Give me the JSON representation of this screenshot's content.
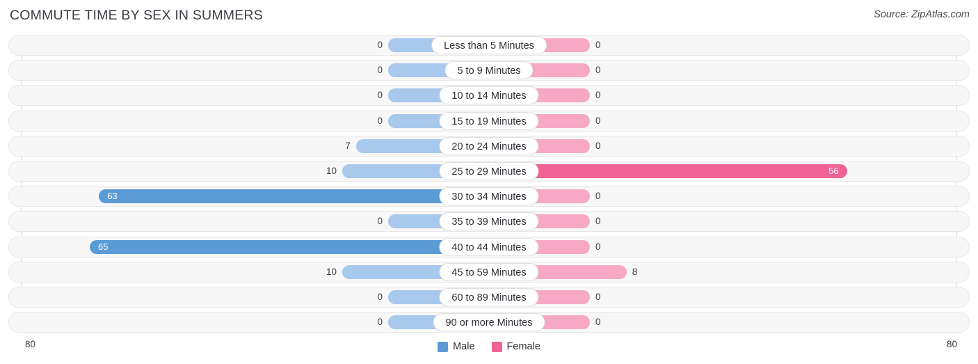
{
  "header": {
    "title": "COMMUTE TIME BY SEX IN SUMMERS",
    "source": "Source: ZipAtlas.com"
  },
  "legend": {
    "male_label": "Male",
    "female_label": "Female",
    "male_color": "#5b9bd5",
    "female_color": "#ef6296"
  },
  "axis": {
    "left_tick": "80",
    "right_tick": "80"
  },
  "colors": {
    "male_strong": "#5b9bd5",
    "male_light": "#a8c8ec",
    "female_strong": "#ef6296",
    "female_light": "#f7a8c4",
    "track_bg": "#f7f7f7",
    "track_border": "#e7e7e7",
    "gridline": "#dcdcdc"
  },
  "chart_data": {
    "type": "bar",
    "subtype": "diverging-bar",
    "title": "COMMUTE TIME BY SEX IN SUMMERS",
    "xlabel": "",
    "ylabel": "",
    "axis_max": 80,
    "xlim": [
      80,
      0,
      80
    ],
    "grid": true,
    "legend_position": "bottom-center",
    "categories": [
      "Less than 5 Minutes",
      "5 to 9 Minutes",
      "10 to 14 Minutes",
      "15 to 19 Minutes",
      "20 to 24 Minutes",
      "25 to 29 Minutes",
      "30 to 34 Minutes",
      "35 to 39 Minutes",
      "40 to 44 Minutes",
      "45 to 59 Minutes",
      "60 to 89 Minutes",
      "90 or more Minutes"
    ],
    "series": [
      {
        "name": "Male",
        "direction": "left",
        "color": "#5b9bd5",
        "values": [
          0,
          0,
          0,
          0,
          7,
          10,
          63,
          0,
          65,
          10,
          0,
          0
        ],
        "labels": [
          "0",
          "0",
          "0",
          "0",
          "7",
          "10",
          "63",
          "0",
          "65",
          "10",
          "0",
          "0"
        ]
      },
      {
        "name": "Female",
        "direction": "right",
        "color": "#ef6296",
        "values": [
          0,
          0,
          0,
          0,
          0,
          56,
          0,
          0,
          0,
          8,
          0,
          0
        ],
        "labels": [
          "0",
          "0",
          "0",
          "0",
          "0",
          "56",
          "0",
          "0",
          "0",
          "8",
          "0",
          "0"
        ]
      }
    ]
  }
}
